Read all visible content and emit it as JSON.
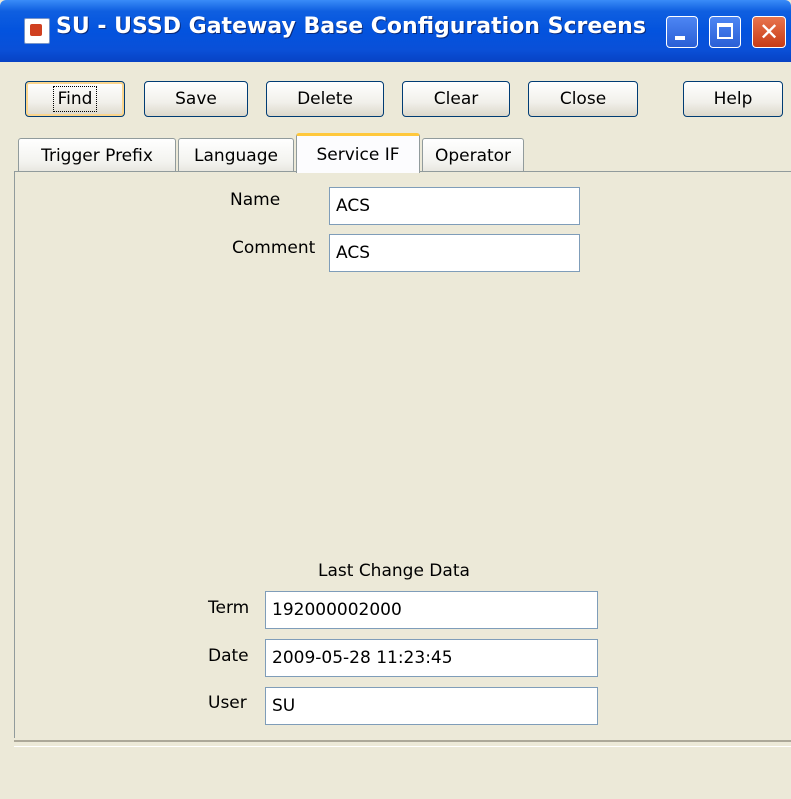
{
  "window": {
    "title": "SU - USSD Gateway Base Configuration Screens",
    "controls": {
      "close_glyph": "✕"
    }
  },
  "toolbar": {
    "find": "Find",
    "save": "Save",
    "delete": "Delete",
    "clear": "Clear",
    "close": "Close",
    "help": "Help"
  },
  "tabs": [
    {
      "label": "Trigger Prefix",
      "selected": false
    },
    {
      "label": "Language",
      "selected": false
    },
    {
      "label": "Service IF",
      "selected": true
    },
    {
      "label": "Operator",
      "selected": false
    }
  ],
  "form": {
    "name_label": "Name",
    "name_value": "ACS",
    "comment_label": "Comment",
    "comment_value": "ACS"
  },
  "last_change": {
    "heading": "Last Change Data",
    "term_label": "Term",
    "term_value": "192000002000",
    "date_label": "Date",
    "date_value": "2009-05-28 11:23:45",
    "user_label": "User",
    "user_value": "SU"
  },
  "colors": {
    "titlebar": "#0353de",
    "window_bg": "#ece9d8",
    "tab_highlight": "#ffc83c"
  }
}
